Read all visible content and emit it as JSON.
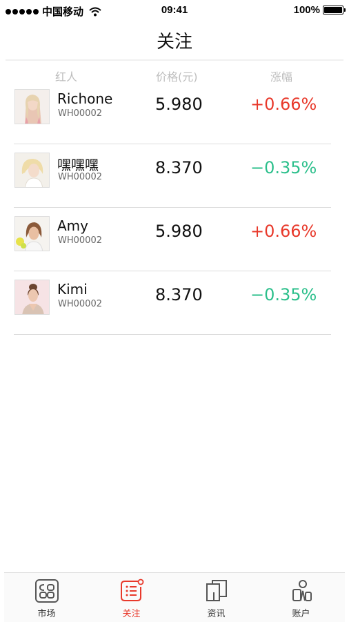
{
  "status_bar": {
    "carrier": "中国移动",
    "time": "09:41",
    "battery": "100%"
  },
  "header": {
    "title": "关注"
  },
  "columns": {
    "star": "红人",
    "price": "价格(元)",
    "change": "涨幅"
  },
  "rows": [
    {
      "name": "Richone",
      "code": "WH00002",
      "price": "5.980",
      "change": "+0.66%",
      "trend": "up"
    },
    {
      "name": "嘿嘿嘿",
      "code": "WH00002",
      "price": "8.370",
      "change": "−0.35%",
      "trend": "down"
    },
    {
      "name": "Amy",
      "code": "WH00002",
      "price": "5.980",
      "change": "+0.66%",
      "trend": "up"
    },
    {
      "name": "Kimi",
      "code": "WH00002",
      "price": "8.370",
      "change": "−0.35%",
      "trend": "down"
    }
  ],
  "tabs": [
    {
      "label": "市场",
      "icon": "market-icon",
      "active": false
    },
    {
      "label": "关注",
      "icon": "watchlist-icon",
      "active": true
    },
    {
      "label": "资讯",
      "icon": "news-icon",
      "active": false
    },
    {
      "label": "账户",
      "icon": "account-icon",
      "active": false
    }
  ],
  "colors": {
    "up": "#e8392b",
    "down": "#2bbf8b",
    "active_tab": "#e8392b"
  }
}
